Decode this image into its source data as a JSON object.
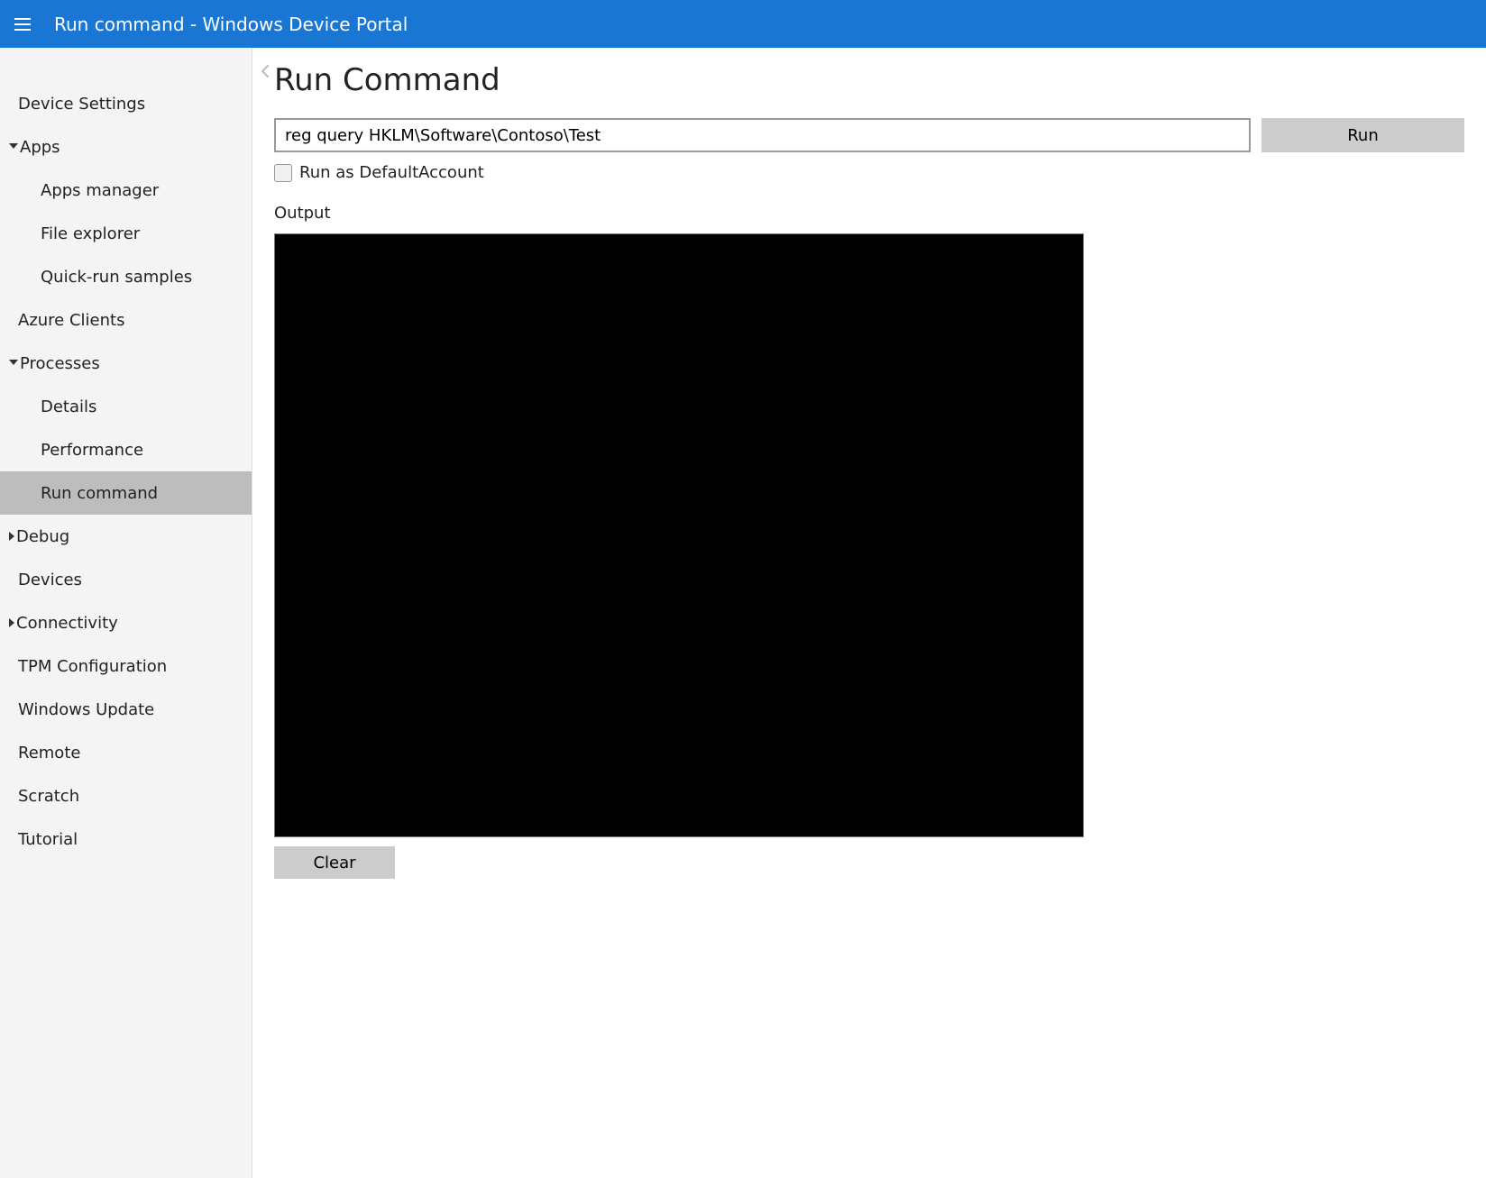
{
  "header": {
    "title": "Run command - Windows Device Portal"
  },
  "sidebar": {
    "items": [
      {
        "label": "Device Settings",
        "level": 1,
        "caret": "none"
      },
      {
        "label": "Apps",
        "level": 1,
        "caret": "open"
      },
      {
        "label": "Apps manager",
        "level": 2,
        "caret": "none"
      },
      {
        "label": "File explorer",
        "level": 2,
        "caret": "none"
      },
      {
        "label": "Quick-run samples",
        "level": 2,
        "caret": "none"
      },
      {
        "label": "Azure Clients",
        "level": 1,
        "caret": "none"
      },
      {
        "label": "Processes",
        "level": 1,
        "caret": "open"
      },
      {
        "label": "Details",
        "level": 2,
        "caret": "none"
      },
      {
        "label": "Performance",
        "level": 2,
        "caret": "none"
      },
      {
        "label": "Run command",
        "level": 2,
        "caret": "none",
        "active": true
      },
      {
        "label": "Debug",
        "level": 1,
        "caret": "closed"
      },
      {
        "label": "Devices",
        "level": 1,
        "caret": "none"
      },
      {
        "label": "Connectivity",
        "level": 1,
        "caret": "closed"
      },
      {
        "label": "TPM Configuration",
        "level": 1,
        "caret": "none"
      },
      {
        "label": "Windows Update",
        "level": 1,
        "caret": "none"
      },
      {
        "label": "Remote",
        "level": 1,
        "caret": "none"
      },
      {
        "label": "Scratch",
        "level": 1,
        "caret": "none"
      },
      {
        "label": "Tutorial",
        "level": 1,
        "caret": "none"
      }
    ]
  },
  "main": {
    "page_title": "Run Command",
    "command_value": "reg query HKLM\\Software\\Contoso\\Test",
    "run_label": "Run",
    "default_account_label": "Run as DefaultAccount",
    "default_account_checked": false,
    "output_label": "Output",
    "output_text": "",
    "clear_label": "Clear"
  }
}
